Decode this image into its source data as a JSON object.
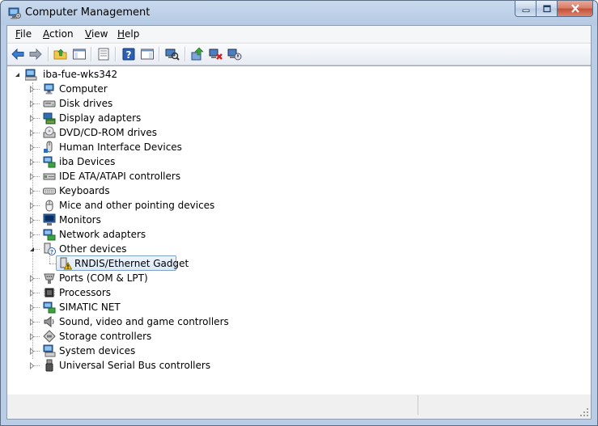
{
  "window": {
    "title": "Computer Management"
  },
  "menu": [
    {
      "label": "File",
      "accel": "F",
      "rest": "ile"
    },
    {
      "label": "Action",
      "accel": "A",
      "rest": "ction"
    },
    {
      "label": "View",
      "accel": "V",
      "rest": "iew"
    },
    {
      "label": "Help",
      "accel": "H",
      "rest": "elp"
    }
  ],
  "toolbar": [
    "back-arrow-icon",
    "forward-arrow-icon",
    "up-folder-icon",
    "show-hide-console-tree-icon",
    "properties-icon",
    "help-icon",
    "action-pane-icon",
    "scan-hardware-icon",
    "update-driver-icon",
    "uninstall-icon",
    "enable-device-icon"
  ],
  "tree": {
    "root": {
      "label": "iba-fue-wks342",
      "icon": "computer-icon",
      "expanded": true
    },
    "categories": [
      {
        "label": "Computer",
        "icon": "computer-icon",
        "expanded": false
      },
      {
        "label": "Disk drives",
        "icon": "disk-drive-icon",
        "expanded": false
      },
      {
        "label": "Display adapters",
        "icon": "display-adapter-icon",
        "expanded": false
      },
      {
        "label": "DVD/CD-ROM drives",
        "icon": "dvd-drive-icon",
        "expanded": false
      },
      {
        "label": "Human Interface Devices",
        "icon": "hid-icon",
        "expanded": false
      },
      {
        "label": "iba Devices",
        "icon": "network-device-icon",
        "expanded": false
      },
      {
        "label": "IDE ATA/ATAPI controllers",
        "icon": "ide-controller-icon",
        "expanded": false
      },
      {
        "label": "Keyboards",
        "icon": "keyboard-icon",
        "expanded": false
      },
      {
        "label": "Mice and other pointing devices",
        "icon": "mouse-icon",
        "expanded": false
      },
      {
        "label": "Monitors",
        "icon": "monitor-icon",
        "expanded": false
      },
      {
        "label": "Network adapters",
        "icon": "network-adapter-icon",
        "expanded": false
      },
      {
        "label": "Other devices",
        "icon": "unknown-device-icon",
        "expanded": true,
        "children": [
          {
            "label": "RNDIS/Ethernet Gadget",
            "icon": "warning-device-icon",
            "selected": true
          }
        ]
      },
      {
        "label": "Ports (COM & LPT)",
        "icon": "port-icon",
        "expanded": false
      },
      {
        "label": "Processors",
        "icon": "processor-icon",
        "expanded": false
      },
      {
        "label": "SIMATIC NET",
        "icon": "network-device-icon",
        "expanded": false
      },
      {
        "label": "Sound, video and game controllers",
        "icon": "speaker-icon",
        "expanded": false
      },
      {
        "label": "Storage controllers",
        "icon": "storage-controller-icon",
        "expanded": false
      },
      {
        "label": "System devices",
        "icon": "system-device-icon",
        "expanded": false
      },
      {
        "label": "Universal Serial Bus controllers",
        "icon": "usb-icon",
        "expanded": false
      }
    ]
  },
  "colors": {
    "selection_border": "#7da2ce",
    "title_glass": "#b9cde6",
    "close_red": "#c44f35"
  }
}
